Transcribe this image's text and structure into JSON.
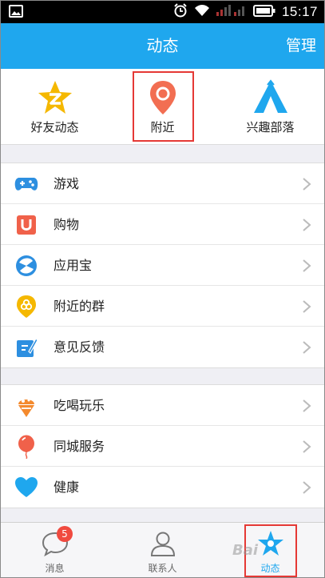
{
  "status_bar": {
    "time": "15:17",
    "icons": [
      "image-icon",
      "alarm-icon",
      "wifi-icon",
      "signal-icon",
      "battery-icon"
    ]
  },
  "nav": {
    "title": "动态",
    "manage_label": "管理"
  },
  "shortcuts": [
    {
      "id": "friends-feed",
      "label": "好友动态",
      "icon": "qzone-star-icon",
      "color": "#f5b800"
    },
    {
      "id": "nearby",
      "label": "附近",
      "icon": "location-pin-icon",
      "color": "#f26e52"
    },
    {
      "id": "interest-tribe",
      "label": "兴趣部落",
      "icon": "tent-icon",
      "color": "#1fa7ee"
    }
  ],
  "group1": [
    {
      "id": "game",
      "label": "游戏",
      "icon": "gamepad-icon",
      "color": "#2d8fe0"
    },
    {
      "id": "shopping",
      "label": "购物",
      "icon": "shopping-bag-icon",
      "color": "#f0614a"
    },
    {
      "id": "app-store",
      "label": "应用宝",
      "icon": "app-store-icon",
      "color": "#2d8fe0"
    },
    {
      "id": "nearby-groups",
      "label": "附近的群",
      "icon": "nearby-group-icon",
      "color": "#f5b800"
    },
    {
      "id": "feedback",
      "label": "意见反馈",
      "icon": "feedback-icon",
      "color": "#2d8fe0"
    }
  ],
  "group2": [
    {
      "id": "food-fun",
      "label": "吃喝玩乐",
      "icon": "ice-cream-icon",
      "color": "#f48a2e"
    },
    {
      "id": "city-service",
      "label": "同城服务",
      "icon": "balloon-icon",
      "color": "#f0614a"
    },
    {
      "id": "health",
      "label": "健康",
      "icon": "heart-icon",
      "color": "#1fa7ee"
    }
  ],
  "tabs": [
    {
      "id": "messages",
      "label": "消息",
      "badge": "5",
      "icon": "chat-bubble-icon"
    },
    {
      "id": "contacts",
      "label": "联系人",
      "icon": "person-icon"
    },
    {
      "id": "activity",
      "label": "动态",
      "icon": "star-icon",
      "active": true
    }
  ],
  "colors": {
    "nav_bg": "#1fa7ee",
    "highlight": "#e53935",
    "page_bg": "#efeff4"
  },
  "watermark": "Bai"
}
